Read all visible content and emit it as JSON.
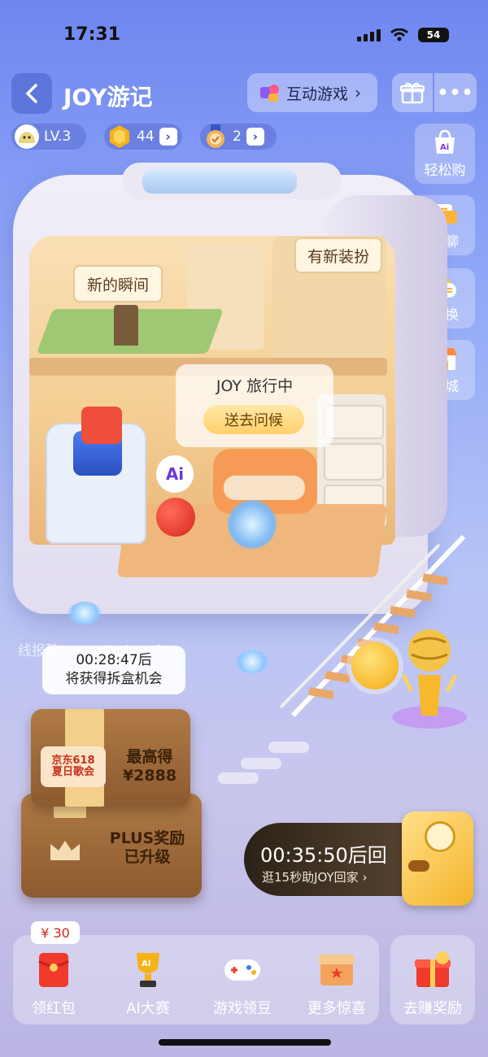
{
  "status_bar": {
    "time": "17:31",
    "battery": "54"
  },
  "header": {
    "title": "JOY游记",
    "games_label": "互动游戏",
    "games_chevron": "›"
  },
  "stats": [
    {
      "name": "level",
      "value": "LV.3"
    },
    {
      "name": "coins",
      "value": "44"
    },
    {
      "name": "medals",
      "value": "2"
    }
  ],
  "side_menu": [
    {
      "label": "轻松购"
    },
    {
      "label": "AI聊"
    },
    {
      "label": "兑换"
    },
    {
      "label": "商城"
    }
  ],
  "scene": {
    "moments_label": "新的瞬间",
    "outfit_label": "有新装扮",
    "travel_status": "JOY 旅行中",
    "greet_button": "送去问候",
    "ai_badge": "Ai"
  },
  "watermark": "线报酷-new.xianbao.fun",
  "unbox_timer": {
    "time": "00:28:47后",
    "subtitle": "将获得拆盒机会"
  },
  "boxes": {
    "logo_line1": "京东618",
    "logo_line2": "夏日歌会",
    "top_line1": "最高得",
    "top_line2": "¥2888",
    "bottom_line1": "PLUS奖励",
    "bottom_line2": "已升级"
  },
  "return_card": {
    "time": "00:35:50后回",
    "subtitle": "逛15秒助JOY回家",
    "chevron": "›"
  },
  "dock": {
    "price_tag": "¥ 30",
    "items": [
      {
        "label": "领红包"
      },
      {
        "label": "AI大赛"
      },
      {
        "label": "游戏领豆"
      },
      {
        "label": "更多惊喜"
      }
    ],
    "earn_label": "去赚奖励"
  },
  "colors": {
    "accent_gold": "#ffd06a",
    "red": "#ef4f3a",
    "bg_top": "#6f86f0",
    "bg_bottom": "#b9b4e2"
  }
}
